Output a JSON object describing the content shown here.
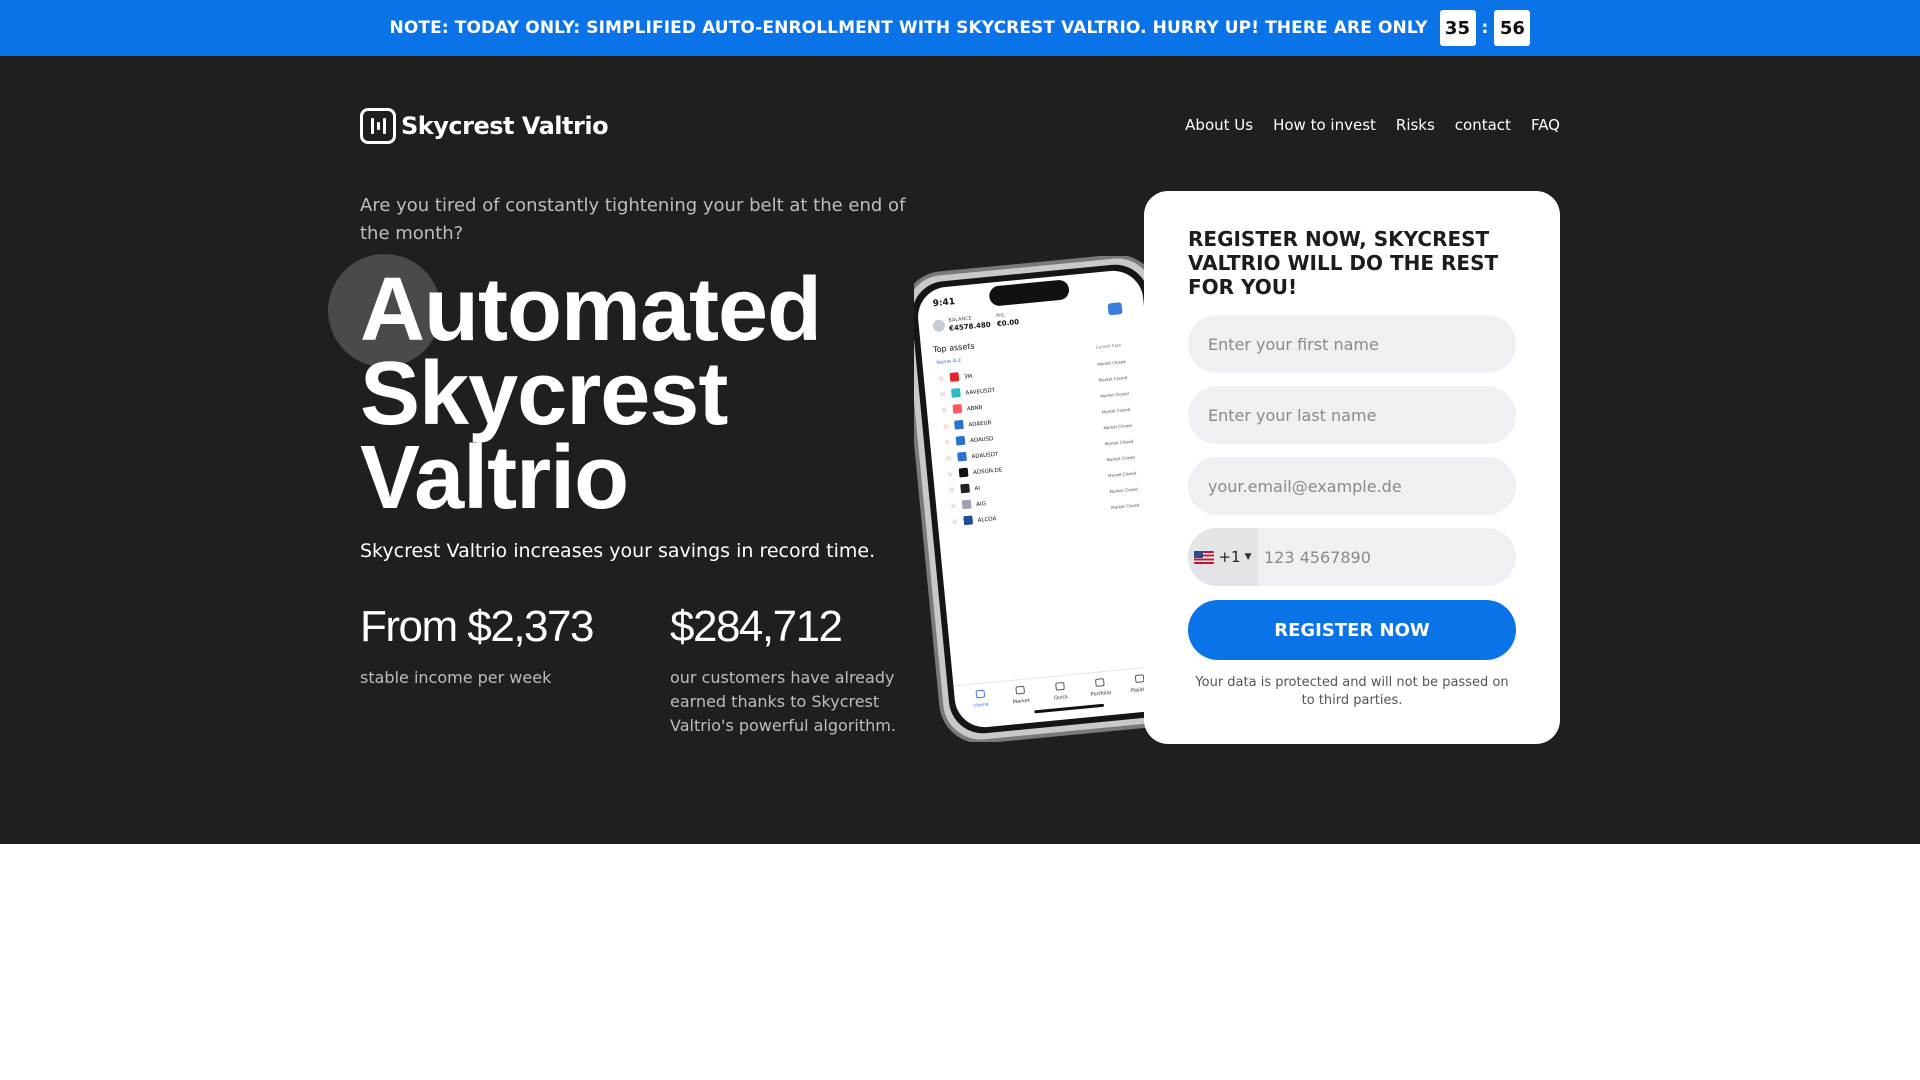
{
  "promo": {
    "message": "NOTE: TODAY ONLY: SIMPLIFIED AUTO-ENROLLMENT WITH SKYCREST VALTRIO. HURRY UP! THERE ARE ONLY",
    "minutes": "35",
    "separator": ":",
    "seconds": "56"
  },
  "brand": {
    "name": "Skycrest Valtrio"
  },
  "nav": [
    "About Us",
    "How to invest",
    "Risks",
    "contact",
    "FAQ"
  ],
  "hero": {
    "tagline": "Are you tired of constantly tightening your belt at the end of the month?",
    "headline": [
      "Automated",
      "Skycrest",
      "Valtrio"
    ],
    "subline": "Skycrest Valtrio increases your savings in record time.",
    "stats": [
      {
        "value": "From $2,373",
        "label": "stable income per week"
      },
      {
        "value": "$284,712",
        "label": "our customers have already earned thanks to Skycrest Valtrio's powerful algorithm."
      }
    ]
  },
  "phone_app": {
    "time": "9:41",
    "balance_label": "BALANCE",
    "balance_value": "€4578.480",
    "pnl_label": "PnL",
    "pnl_value": "€0.00",
    "section_title": "Top assets",
    "filter": "Name A-Z",
    "column": "Current Rate",
    "assets": [
      {
        "name": "3M",
        "status": "Market Closed",
        "color": "#e4262b"
      },
      {
        "name": "AAVEUSDT",
        "status": "Market Closed",
        "color": "#2ebac6"
      },
      {
        "name": "ABNB",
        "status": "Market Closed",
        "color": "#ff5a5f"
      },
      {
        "name": "ADAEUR",
        "status": "Market Closed",
        "color": "#2a71d0"
      },
      {
        "name": "ADAUSD",
        "status": "Market Closed",
        "color": "#2a71d0"
      },
      {
        "name": "ADAUSDT",
        "status": "Market Closed",
        "color": "#2a71d0"
      },
      {
        "name": "ADSGN.DE",
        "status": "Market Closed",
        "color": "#111111"
      },
      {
        "name": "AI",
        "status": "Market Closed",
        "color": "#222222"
      },
      {
        "name": "AIG",
        "status": "Market Closed",
        "color": "#9aa3ad"
      },
      {
        "name": "ALCOA",
        "status": "Market Closed",
        "color": "#1d4f91"
      }
    ],
    "tabs": [
      "Home",
      "Market",
      "Quick",
      "Portfolio",
      "Position"
    ]
  },
  "form": {
    "title": "REGISTER NOW, SKYCREST VALTRIO WILL DO THE REST FOR YOU!",
    "first_name_placeholder": "Enter your first name",
    "last_name_placeholder": "Enter your last name",
    "email_placeholder": "your.email@example.de",
    "country_code": "+1",
    "phone_placeholder": "123 4567890",
    "submit_label": "REGISTER NOW",
    "privacy": "Your data is protected and will not be passed on to third parties."
  },
  "colors": {
    "accent": "#0b73e8",
    "hero_bg": "#1f1f1f",
    "card_bg": "#ffffff"
  }
}
